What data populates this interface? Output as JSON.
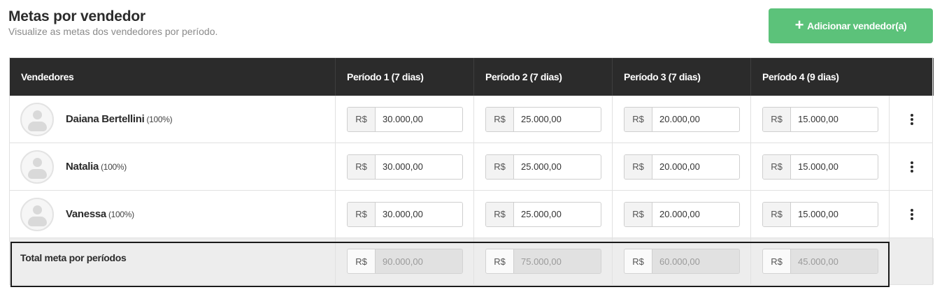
{
  "header": {
    "title": "Metas por vendedor",
    "subtitle": "Visualize as metas dos vendedores por período."
  },
  "add_button": {
    "icon": "plus-icon",
    "label": "Adicionar vendedor(a)",
    "color": "#5cc27a"
  },
  "table": {
    "columns": [
      "Vendedores",
      "Período 1 (7 dias)",
      "Período 2 (7 dias)",
      "Período 3 (7 dias)",
      "Período 4 (9 dias)"
    ],
    "currency_prefix": "R$",
    "rows": [
      {
        "name": "Daiana Bertellini",
        "percent": "(100%)",
        "values": [
          "30.000,00",
          "25.000,00",
          "20.000,00",
          "15.000,00"
        ],
        "menu_icon": "kebab-menu-icon"
      },
      {
        "name": "Natalia",
        "percent": "(100%)",
        "values": [
          "30.000,00",
          "25.000,00",
          "20.000,00",
          "15.000,00"
        ],
        "menu_icon": "kebab-menu-icon"
      },
      {
        "name": "Vanessa",
        "percent": "(100%)",
        "values": [
          "30.000,00",
          "25.000,00",
          "20.000,00",
          "15.000,00"
        ],
        "menu_icon": "kebab-menu-icon"
      }
    ],
    "total": {
      "label": "Total meta por períodos",
      "values": [
        "90.000,00",
        "75.000,00",
        "60.000,00",
        "45.000,00"
      ]
    }
  },
  "colors": {
    "header_bg": "#2b2b2b",
    "accent": "#5cc27a",
    "total_bg": "#ededed"
  }
}
